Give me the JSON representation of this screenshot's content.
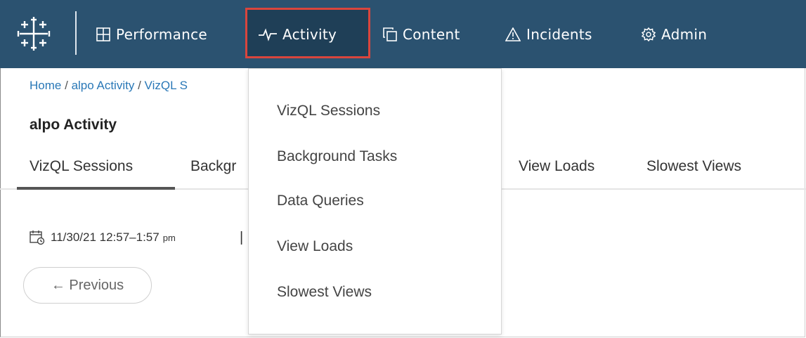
{
  "nav": {
    "items": [
      {
        "label": "Performance",
        "icon": "grid-icon"
      },
      {
        "label": "Activity",
        "icon": "pulse-icon"
      },
      {
        "label": "Content",
        "icon": "copy-icon"
      },
      {
        "label": "Incidents",
        "icon": "warning-icon"
      },
      {
        "label": "Admin",
        "icon": "gear-icon"
      }
    ],
    "active": "Activity",
    "colors": {
      "bar": "#2b5270",
      "highlight": "#d9453d"
    }
  },
  "breadcrumb": {
    "home": "Home",
    "separator": "/",
    "section": "alpo Activity",
    "current": "VizQL S"
  },
  "page": {
    "title": "alpo Activity"
  },
  "tabs": [
    {
      "label": "VizQL Sessions",
      "selected": true
    },
    {
      "label": "Backgr",
      "selected": false
    },
    {
      "label": "View Loads",
      "selected": false
    },
    {
      "label": "Slowest Views",
      "selected": false
    }
  ],
  "date_range": {
    "value": "11/30/21 12:57–1:57",
    "suffix": "pm",
    "pipe": "|"
  },
  "previous_button": {
    "label": "← Previous"
  },
  "activity_menu": {
    "items": [
      "VizQL Sessions",
      "Background Tasks",
      "Data Queries",
      "View Loads",
      "Slowest Views"
    ]
  }
}
